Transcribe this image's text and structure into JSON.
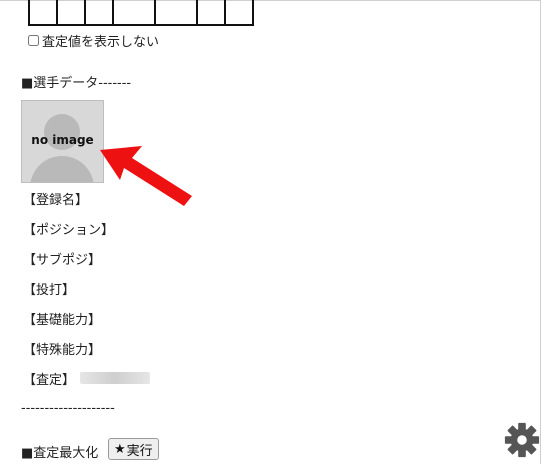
{
  "stats_table": {
    "columns": 7
  },
  "hide_rating_checkbox": {
    "label": "査定値を表示しない",
    "checked": false
  },
  "player_section": {
    "header": "■選手データ-------",
    "photo": {
      "text": "no image"
    },
    "fields": [
      {
        "label": "【登録名】"
      },
      {
        "label": "【ポジション】"
      },
      {
        "label": "【サブポジ】"
      },
      {
        "label": "【投打】"
      },
      {
        "label": "【基礎能力】"
      },
      {
        "label": "【特殊能力】"
      },
      {
        "label": "【査定】"
      }
    ],
    "divider": "--------------------"
  },
  "maximize": {
    "label": "■査定最大化",
    "button_label": "実行",
    "button_icon": "star-icon"
  },
  "settings": {
    "icon": "gear-icon"
  },
  "colors": {
    "arrow": "#ee1111",
    "photo_bg": "#d8d8d8"
  }
}
